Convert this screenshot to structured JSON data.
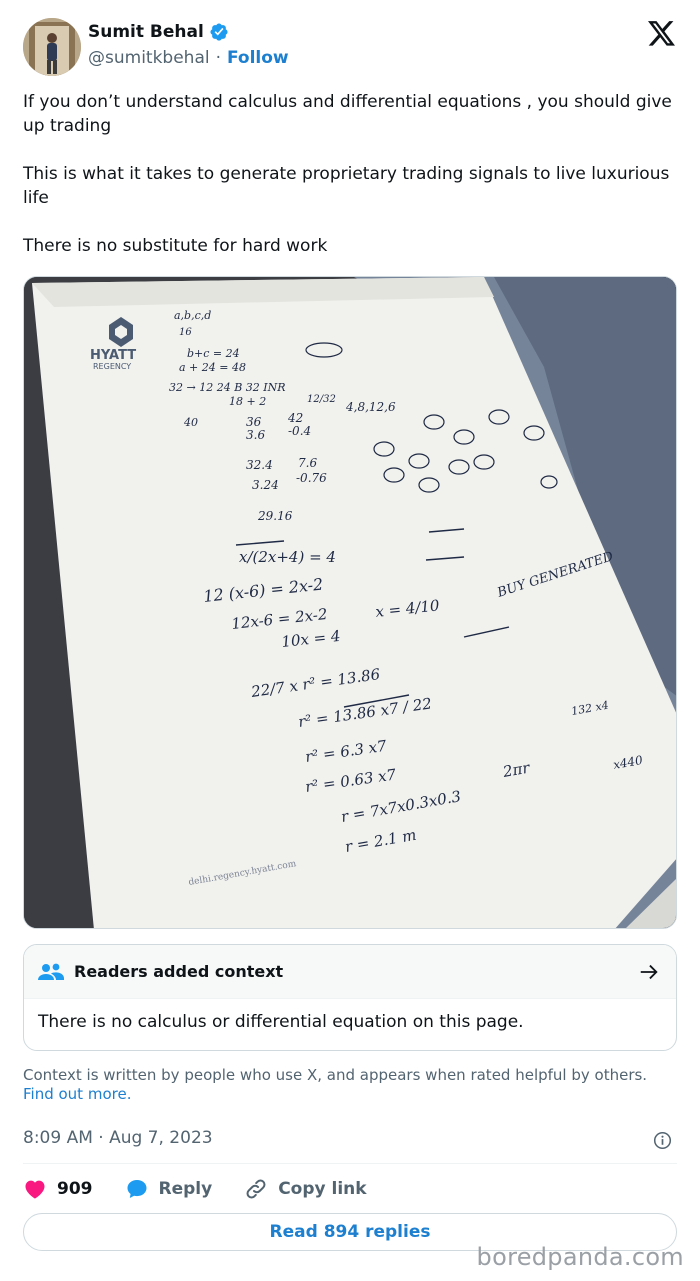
{
  "author": {
    "name": "Sumit Behal",
    "handle": "@sumitkbehal",
    "separator": "·",
    "follow_label": "Follow"
  },
  "tweet": {
    "paragraphs": [
      "If you don’t understand calculus and differential equations , you should give up trading",
      "This is what it takes to generate proprietary trading signals to live luxurious life",
      "There is no substitute for hard work"
    ]
  },
  "media": {
    "hotel_logo_line1": "HYATT",
    "hotel_logo_line2": "REGENCY",
    "footer_url": "delhi.regency.hyatt.com",
    "handwriting": [
      "a,b,c,d",
      "16",
      "b+c = 24",
      "a + 24 = 48",
      "32 → 12  24  B  32 INR",
      "18 + 2",
      "12/32",
      "4,8,12,6",
      "40",
      "36",
      "42",
      "3.6",
      "-0.4",
      "32.4",
      "7.6",
      "3.24",
      "-0.76",
      "29.16",
      "x/(2x+4) = 4",
      "12 (x-6) = 2x-2",
      "12x-6 = 2x-2",
      "10x = 4",
      "x = 4/10",
      "BUY GENERATED",
      "22/7 x r² = 13.86",
      "r² = 13.86 x7 / 22",
      "r² = 6.3 x7",
      "r² = 0.63 x7",
      "r = 7x7x0.3x0.3",
      "r = 2.1 m",
      "2πr",
      "x440",
      "132 x4"
    ]
  },
  "context": {
    "title": "Readers added context",
    "body": "There is no calculus or differential equation on this page.",
    "note": "Context is written by people who use X, and appears when rated helpful by others.",
    "link": "Find out more."
  },
  "timestamp": "8:09 AM · Aug 7, 2023",
  "actions": {
    "likes": "909",
    "reply": "Reply",
    "copy_link": "Copy link"
  },
  "read_replies": "Read 894 replies",
  "watermark": "boredpanda.com",
  "colors": {
    "link_blue": "#1d7fcf",
    "like_red": "#f91880",
    "verified_blue": "#1d9bf0",
    "muted_text": "#536471"
  }
}
